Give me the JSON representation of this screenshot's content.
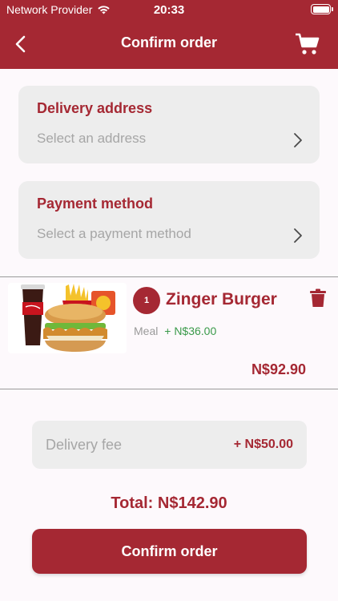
{
  "status_bar": {
    "carrier": "Network Provider",
    "time": "20:33",
    "wifi_icon": "wifi-icon",
    "battery_icon": "battery-icon"
  },
  "nav": {
    "title": "Confirm order",
    "back_icon": "chevron-left-icon",
    "cart_icon": "cart-icon"
  },
  "delivery_address": {
    "title": "Delivery address",
    "placeholder": "Select an address"
  },
  "payment_method": {
    "title": "Payment method",
    "placeholder": "Select a payment method"
  },
  "order_item": {
    "quantity": "1",
    "name": "Zinger Burger",
    "option": "Meal",
    "option_price": "+ N$36.00",
    "total": "N$92.90",
    "image_icon": "burger-meal-image",
    "delete_icon": "trash-icon"
  },
  "delivery_fee": {
    "label": "Delivery fee",
    "value": "+ N$50.00"
  },
  "total": "Total: N$142.90",
  "confirm_button": "Confirm order",
  "colors": {
    "brand": "#a52833",
    "card_bg": "#ededed",
    "placeholder": "#a6a6a6",
    "price_add": "#3a9a4a",
    "page_bg": "#fdf9fc"
  }
}
